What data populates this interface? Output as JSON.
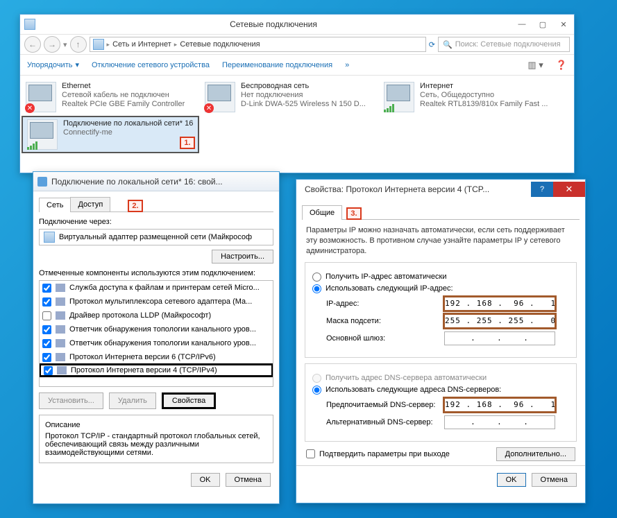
{
  "main_window": {
    "title": "Сетевые подключения",
    "win_controls": {
      "min": "—",
      "max": "▢",
      "close": "✕"
    },
    "nav": {
      "back": "←",
      "forward": "→",
      "up": "↑"
    },
    "breadcrumb": {
      "seg1": "Сеть и Интернет",
      "seg2": "Сетевые подключения"
    },
    "search_placeholder": "Поиск: Сетевые подключения",
    "orgbar": {
      "organize": "Упорядочить",
      "disable": "Отключение сетевого устройства",
      "rename": "Переименование подключения"
    },
    "connections": [
      {
        "name": "Ethernet",
        "status": "Сетевой кабель не подключен",
        "device": "Realtek PCIe GBE Family Controller",
        "error": true
      },
      {
        "name": "Беспроводная сеть",
        "status": "Нет подключения",
        "device": "D-Link DWA-525 Wireless N 150 D...",
        "error": true
      },
      {
        "name": "Интернет",
        "status": "Сеть, Общедоступно",
        "device": "Realtek RTL8139/810x Family Fast ...",
        "error": false
      },
      {
        "name": "Подключение по локальной сети* 16",
        "status": "",
        "device": "Connectify-me",
        "error": false,
        "selected": true
      }
    ],
    "callouts": {
      "one": "1."
    }
  },
  "props_window": {
    "title": "Подключение по локальной сети* 16: свой...",
    "tabs": {
      "net": "Сеть",
      "share": "Доступ"
    },
    "callout": "2.",
    "conn_via_label": "Подключение через:",
    "conn_via_value": "Виртуальный адаптер размещенной сети (Майкрософ",
    "configure_btn": "Настроить...",
    "components_label": "Отмеченные компоненты используются этим подключением:",
    "components": [
      {
        "checked": true,
        "label": "Служба доступа к файлам и принтерам сетей Micro..."
      },
      {
        "checked": true,
        "label": "Протокол мультиплексора сетевого адаптера (Ма..."
      },
      {
        "checked": false,
        "label": "Драйвер протокола LLDP (Майкрософт)"
      },
      {
        "checked": true,
        "label": "Ответчик обнаружения топологии канального уров..."
      },
      {
        "checked": true,
        "label": "Ответчик обнаружения топологии канального уров..."
      },
      {
        "checked": true,
        "label": "Протокол Интернета версии 6 (TCP/IPv6)"
      },
      {
        "checked": true,
        "label": "Протокол Интернета версии 4 (TCP/IPv4)",
        "highlight": true
      }
    ],
    "buttons": {
      "install": "Установить...",
      "remove": "Удалить",
      "props": "Свойства"
    },
    "desc_title": "Описание",
    "desc_body": "Протокол TCP/IP - стандартный протокол глобальных сетей, обеспечивающий связь между различными взаимодействующими сетями.",
    "dlg": {
      "ok": "OK",
      "cancel": "Отмена"
    }
  },
  "ipv4_window": {
    "title": "Свойства: Протокол Интернета версии 4 (TCP...",
    "tab_general": "Общие",
    "callout": "3.",
    "note": "Параметры IP можно назначать автоматически, если сеть поддерживает эту возможность. В противном случае узнайте параметры IP у сетевого администратора.",
    "radio_auto_ip": "Получить IP-адрес автоматически",
    "radio_use_ip": "Использовать следующий IP-адрес:",
    "ip_label": "IP-адрес:",
    "ip_value": "192 . 168 .  96 .   1",
    "mask_label": "Маска подсети:",
    "mask_value": "255 . 255 . 255 .   0",
    "gw_label": "Основной шлюз:",
    "gw_value": "   .    .    .   ",
    "radio_auto_dns": "Получить адрес DNS-сервера автоматически",
    "radio_use_dns": "Использовать следующие адреса DNS-серверов:",
    "dns1_label": "Предпочитаемый DNS-сервер:",
    "dns1_value": "192 . 168 .  96 .   1",
    "dns2_label": "Альтернативный DNS-сервер:",
    "dns2_value": "   .    .    .   ",
    "confirm_exit": "Подтвердить параметры при выходе",
    "advanced": "Дополнительно...",
    "ok": "OK",
    "cancel": "Отмена"
  }
}
